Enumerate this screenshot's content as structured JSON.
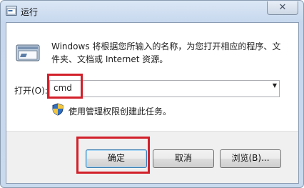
{
  "window": {
    "title": "运行",
    "close_label": "✕"
  },
  "dialog": {
    "description": "Windows 将根据您所输入的名称，为您打开相应的程序、文件夹、文档或 Internet 资源。",
    "open_label": "打开(O):",
    "command_value": "cmd",
    "admin_note": "使用管理权限创建此任务。"
  },
  "buttons": {
    "ok": "确定",
    "cancel": "取消",
    "browse": "浏览(B)..."
  },
  "icons": {
    "title": "run-icon",
    "dialog": "run-icon",
    "admin": "shield-icon",
    "dropdown": "chevron-down-icon"
  },
  "highlight_color": "#d2202a"
}
